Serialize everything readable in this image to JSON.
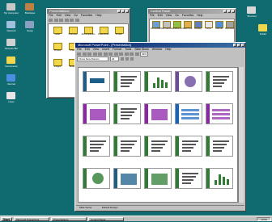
{
  "desktop": {
    "icons": [
      {
        "label": "My Computer",
        "icon": "computer-icon",
        "color": "#c8c8c8"
      },
      {
        "label": "Network",
        "icon": "network-icon",
        "color": "#a0c0e0"
      },
      {
        "label": "Recycle Bin",
        "icon": "recycle-bin-icon",
        "color": "#d0d0d0"
      },
      {
        "label": "Documents",
        "icon": "folder-icon",
        "color": "#f2d64b"
      },
      {
        "label": "Internet",
        "icon": "globe-icon",
        "color": "#4a8fe0"
      },
      {
        "label": "Inbox",
        "icon": "inbox-icon",
        "color": "#e6e6e6"
      },
      {
        "label": "Briefcase",
        "icon": "briefcase-icon",
        "color": "#c08040"
      },
      {
        "label": "Setup",
        "icon": "setup-icon",
        "color": "#8aa0c0"
      }
    ],
    "right_icons": [
      {
        "label": "Shortcut",
        "icon": "shortcut-icon",
        "color": "#d8d8d8"
      },
      {
        "label": "Folder",
        "icon": "folder-icon",
        "color": "#f2d64b"
      }
    ]
  },
  "explorer1": {
    "title": "Presentations",
    "menu": [
      "File",
      "Edit",
      "View",
      "Go",
      "Favorites",
      "Help"
    ],
    "files": [
      "Letter",
      "Overview",
      "AtrCompanion",
      "PowerPoint",
      "Project",
      "Photos",
      "Charts",
      "Notes",
      "Tables",
      "Archive",
      "Images",
      "Budget",
      "Templates",
      "Drafts"
    ]
  },
  "explorer2": {
    "title": "Control Panel",
    "menu": [
      "File",
      "Edit",
      "View",
      "Go",
      "Favorites",
      "Help"
    ],
    "files": [
      "Accessibility",
      "Add Hardware",
      "Add/Remove",
      "Date/Time",
      "Display",
      "Fonts",
      "Internet",
      "Keyboard"
    ]
  },
  "ppt": {
    "title": "Microsoft PowerPoint - [Presentation]",
    "menu": [
      "File",
      "Edit",
      "View",
      "Insert",
      "Format",
      "Tools",
      "Slide Show",
      "Window",
      "Help"
    ],
    "font_name": "Times New Roman",
    "font_size": "24",
    "zoom": "33%",
    "status": [
      "Slide Sorter",
      "Default Design"
    ],
    "slides": [
      {
        "n": "1",
        "kind": "title",
        "accent": "#1b5e8a"
      },
      {
        "n": "2",
        "kind": "bullets",
        "accent": "#2e7d32"
      },
      {
        "n": "3",
        "kind": "chart",
        "accent": "#2e7d32"
      },
      {
        "n": "4",
        "kind": "diagram",
        "accent": "#6a4c9c"
      },
      {
        "n": "5",
        "kind": "bullets",
        "accent": "#2e7d32"
      },
      {
        "n": "6",
        "kind": "image",
        "accent": "#8e24aa"
      },
      {
        "n": "7",
        "kind": "bullets",
        "accent": "#2e7d32"
      },
      {
        "n": "8",
        "kind": "image",
        "accent": "#8e24aa"
      },
      {
        "n": "9",
        "kind": "table",
        "accent": "#1565c0"
      },
      {
        "n": "10",
        "kind": "table",
        "accent": "#8e24aa"
      },
      {
        "n": "11",
        "kind": "bullets",
        "accent": "#2e7d32"
      },
      {
        "n": "12",
        "kind": "bullets",
        "accent": "#2e7d32"
      },
      {
        "n": "13",
        "kind": "bullets",
        "accent": "#2e7d32"
      },
      {
        "n": "14",
        "kind": "bullets",
        "accent": "#2e7d32"
      },
      {
        "n": "15",
        "kind": "bullets",
        "accent": "#2e7d32"
      },
      {
        "n": "16",
        "kind": "diagram",
        "accent": "#2e7d32"
      },
      {
        "n": "17",
        "kind": "image",
        "accent": "#1b5e8a"
      },
      {
        "n": "18",
        "kind": "image",
        "accent": "#2e7d32"
      },
      {
        "n": "19",
        "kind": "bullets",
        "accent": "#2e7d32"
      },
      {
        "n": "20",
        "kind": "chart",
        "accent": "#2e7d32"
      }
    ]
  },
  "taskbar": {
    "start": "Start",
    "tasks": [
      "Microsoft PowerPoint",
      "Presentations",
      "Control Panel"
    ],
    "clock": "12:00"
  },
  "colors": {
    "desktop": "#0f6b6f",
    "title_active": "#08246b",
    "window": "#c0c0c0"
  }
}
